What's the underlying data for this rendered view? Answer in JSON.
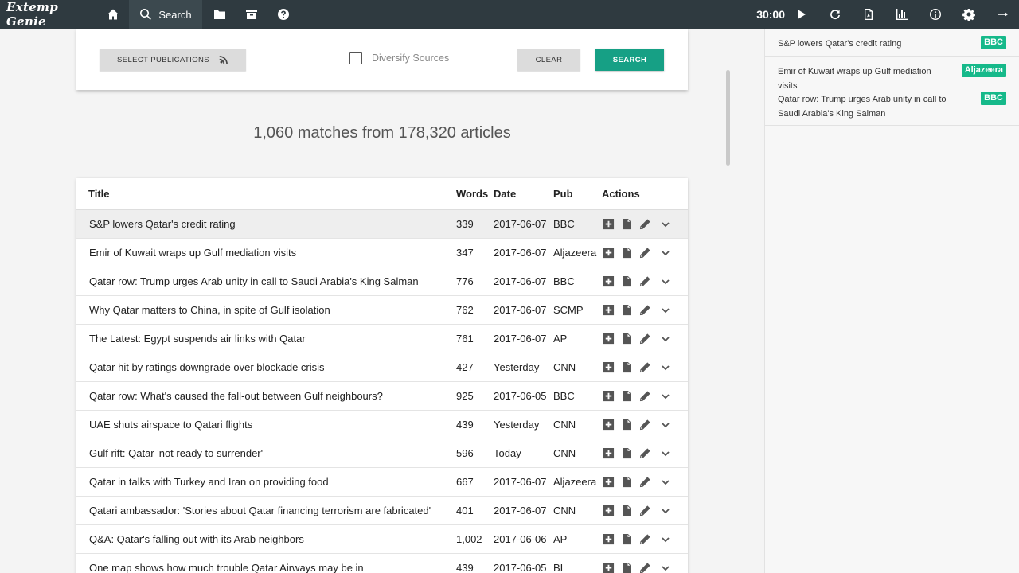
{
  "app": {
    "title": "Extemp Genie"
  },
  "nav": {
    "search_label": "Search",
    "timer": "30:00"
  },
  "search_panel": {
    "select_publications_label": "SELECT PUBLICATIONS",
    "diversify_label": "Diversify Sources",
    "diversify_checked": false,
    "clear_label": "CLEAR",
    "search_label": "SEARCH"
  },
  "summary": {
    "text": "1,060 matches from 178,320 articles"
  },
  "table": {
    "headers": {
      "title": "Title",
      "words": "Words",
      "date": "Date",
      "pub": "Pub",
      "actions": "Actions"
    },
    "rows": [
      {
        "title": "S&P lowers Qatar's credit rating",
        "words": "339",
        "date": "2017-06-07",
        "pub": "BBC"
      },
      {
        "title": "Emir of Kuwait wraps up Gulf mediation visits",
        "words": "347",
        "date": "2017-06-07",
        "pub": "Aljazeera"
      },
      {
        "title": "Qatar row: Trump urges Arab unity in call to Saudi Arabia's King Salman",
        "words": "776",
        "date": "2017-06-07",
        "pub": "BBC"
      },
      {
        "title": "Why Qatar matters to China, in spite of Gulf isolation",
        "words": "762",
        "date": "2017-06-07",
        "pub": "SCMP"
      },
      {
        "title": "The Latest: Egypt suspends air links with Qatar",
        "words": "761",
        "date": "2017-06-07",
        "pub": "AP"
      },
      {
        "title": "Qatar hit by ratings downgrade over blockade crisis",
        "words": "427",
        "date": "Yesterday",
        "pub": "CNN"
      },
      {
        "title": "Qatar row: What's caused the fall-out between Gulf neighbours?",
        "words": "925",
        "date": "2017-06-05",
        "pub": "BBC"
      },
      {
        "title": "UAE shuts airspace to Qatari flights",
        "words": "439",
        "date": "Yesterday",
        "pub": "CNN"
      },
      {
        "title": "Gulf rift: Qatar 'not ready to surrender'",
        "words": "596",
        "date": "Today",
        "pub": "CNN"
      },
      {
        "title": "Qatar in talks with Turkey and Iran on providing food",
        "words": "667",
        "date": "2017-06-07",
        "pub": "Aljazeera"
      },
      {
        "title": "Qatari ambassador: 'Stories about Qatar financing terrorism are fabricated'",
        "words": "401",
        "date": "2017-06-07",
        "pub": "CNN"
      },
      {
        "title": "Q&A: Qatar's falling out with its Arab neighbors",
        "words": "1,002",
        "date": "2017-06-06",
        "pub": "AP"
      },
      {
        "title": "One map shows how much trouble Qatar Airways may be in",
        "words": "439",
        "date": "2017-06-05",
        "pub": "BI"
      }
    ]
  },
  "saved_articles": [
    {
      "title": "S&P lowers Qatar's credit rating",
      "pub": "BBC"
    },
    {
      "title": "Emir of Kuwait wraps up Gulf mediation visits",
      "pub": "Aljazeera"
    },
    {
      "title": "Qatar row: Trump urges Arab unity in call to Saudi Arabia's King Salman",
      "pub": "BBC"
    }
  ],
  "icons": {
    "home": "home-icon",
    "search": "search-icon",
    "folder": "folder-icon",
    "archive": "archive-icon",
    "help": "help-icon",
    "play": "play-icon",
    "refresh": "refresh-icon",
    "pdf": "pdf-icon",
    "stats": "bar-chart-icon",
    "info": "info-icon",
    "settings": "gear-icon",
    "logout": "logout-icon",
    "rss": "rss-icon",
    "add": "plus-square-icon",
    "document": "document-icon",
    "edit": "pencil-icon",
    "expand": "chevron-down-icon"
  },
  "colors": {
    "topbar": "#2f3a40",
    "accent": "#16a085",
    "badge": "#16b98a"
  }
}
